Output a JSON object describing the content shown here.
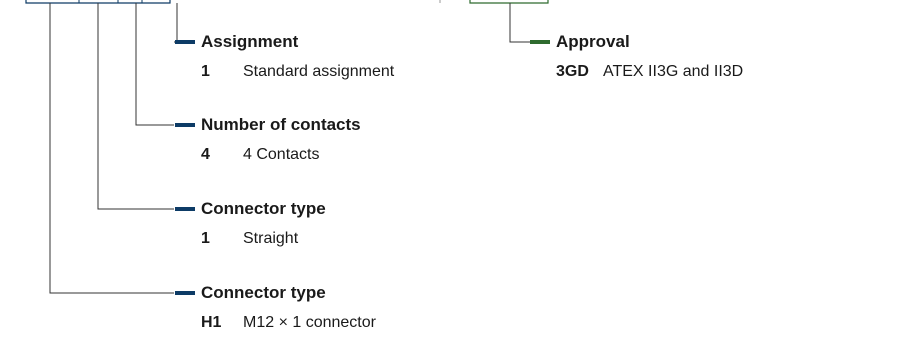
{
  "colors": {
    "navy": "#0d3b66",
    "green": "#2e6b2e",
    "connector_line": "#333333"
  },
  "fields": [
    {
      "heading": "Assignment",
      "code": "1",
      "description": "Standard assignment",
      "accent": "navy"
    },
    {
      "heading": "Number of contacts",
      "code": "4",
      "description": "4 Contacts",
      "accent": "navy"
    },
    {
      "heading": "Connector type",
      "code": "1",
      "description": "Straight",
      "accent": "navy"
    },
    {
      "heading": "Connector type",
      "code": "H1",
      "description": "M12 × 1 connector",
      "accent": "navy"
    },
    {
      "heading": "Approval",
      "code": "3GD",
      "description": "ATEX II3G and II3D",
      "accent": "green"
    }
  ]
}
